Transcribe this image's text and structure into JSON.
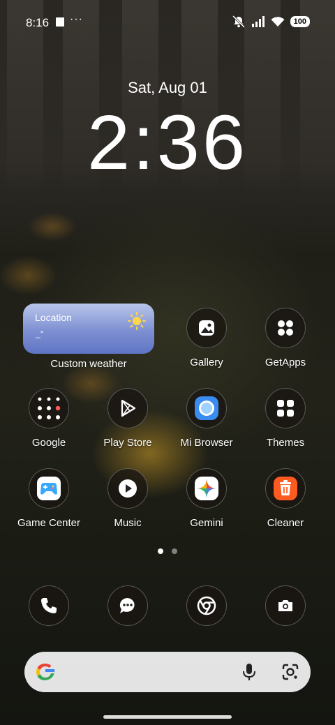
{
  "status_bar": {
    "time": "8:16",
    "more": "···",
    "battery": "100"
  },
  "lock": {
    "date": "Sat, Aug 01",
    "time": "2:36"
  },
  "weather_widget": {
    "location": "Location",
    "temperature": "_°",
    "label": "Custom weather"
  },
  "apps": {
    "gallery": "Gallery",
    "getapps": "GetApps",
    "google": "Google",
    "play_store": "Play Store",
    "mi_browser": "Mi Browser",
    "themes": "Themes",
    "game_center": "Game Center",
    "music": "Music",
    "gemini": "Gemini",
    "cleaner": "Cleaner"
  },
  "dock": [
    "phone-icon",
    "messages-icon",
    "chrome-icon",
    "camera-icon"
  ],
  "colors": {
    "weather_gradient_top": "#b8c6ea",
    "weather_gradient_bottom": "#5f75c4",
    "cleaner_orange": "#ff5a1f",
    "mi_browser_blue": "#3b8cf0",
    "game_center_blue": "#3aa7ff"
  }
}
